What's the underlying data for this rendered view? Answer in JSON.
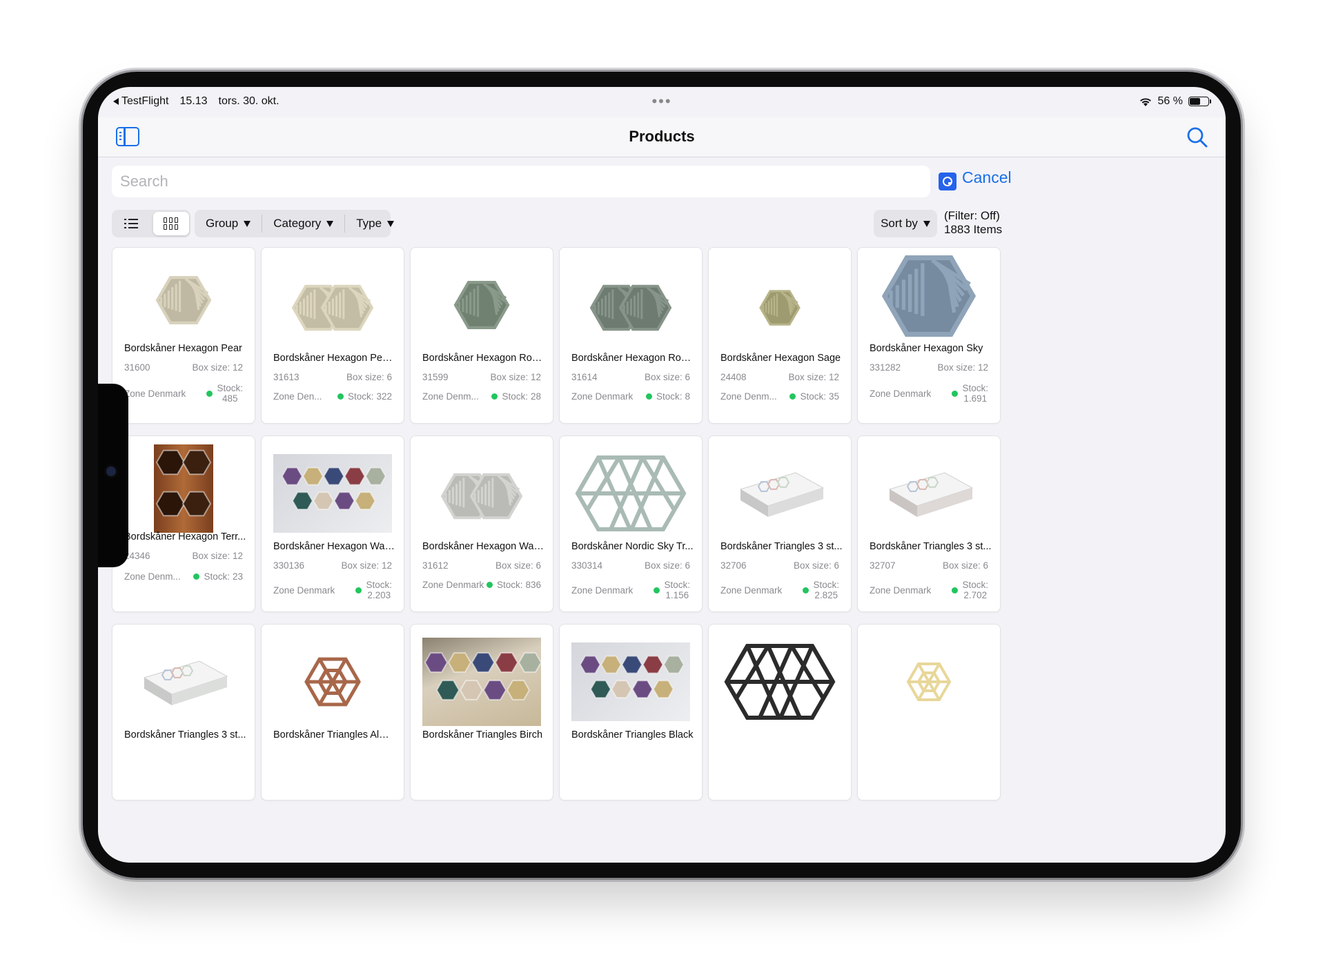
{
  "status_bar": {
    "back_app": "TestFlight",
    "time": "15.13",
    "date": "tors. 30. okt.",
    "center_dots": "•••",
    "battery": "56 %",
    "battery_level": 0.56
  },
  "nav": {
    "title": "Products"
  },
  "search": {
    "placeholder": "Search",
    "cancel_label": "Cancel"
  },
  "filters": {
    "group_label": "Group",
    "category_label": "Category",
    "type_label": "Type",
    "sort_label": "Sort by",
    "filter_state": "(Filter: Off)",
    "item_count": "1883 Items"
  },
  "products": [
    {
      "name": "Bordskåner Hexagon Pear",
      "sku": "31600",
      "box": "Box size: 12",
      "zone": "Zone Denmark",
      "stock_label": "Stock:",
      "stock": "485",
      "color": "#d8d2bd",
      "shape": "hex-small"
    },
    {
      "name": "Bordskåner Hexagon Pea...",
      "sku": "31613",
      "box": "Box size: 6",
      "zone": "Zone Den...",
      "stock_label": "Stock:",
      "stock": "322",
      "color": "#ddd6be",
      "shape": "hex-double"
    },
    {
      "name": "Bordskåner Hexagon Ros...",
      "sku": "31599",
      "box": "Box size: 12",
      "zone": "Zone Denm...",
      "stock_label": "Stock:",
      "stock": "28",
      "color": "#8a9a8a",
      "shape": "hex-small"
    },
    {
      "name": "Bordskåner Hexagon Ros...",
      "sku": "31614",
      "box": "Box size: 6",
      "zone": "Zone Denmark",
      "stock_label": "Stock:",
      "stock": "8",
      "color": "#86948a",
      "shape": "hex-double"
    },
    {
      "name": "Bordskåner Hexagon Sage",
      "sku": "24408",
      "box": "Box size: 12",
      "zone": "Zone Denm...",
      "stock_label": "Stock:",
      "stock": "35",
      "color": "#b8b48a",
      "shape": "hex-tiny"
    },
    {
      "name": "Bordskåner Hexagon Sky",
      "sku": "331282",
      "box": "Box size: 12",
      "zone": "Zone Denmark",
      "stock_label": "Stock:",
      "stock": "1.691",
      "color": "#8fa4b8",
      "shape": "hex-large"
    },
    {
      "name": "Bordskåner Hexagon Terr...",
      "sku": "24346",
      "box": "Box size: 12",
      "zone": "Zone Denm...",
      "stock_label": "Stock:",
      "stock": "23",
      "color": "#8a4f2c",
      "shape": "photo-wood"
    },
    {
      "name": "Bordskåner Hexagon War...",
      "sku": "330136",
      "box": "Box size: 12",
      "zone": "Zone Denmark",
      "stock_label": "Stock:",
      "stock": "2.203",
      "color": "#6b5a7a",
      "shape": "photo-multi"
    },
    {
      "name": "Bordskåner Hexagon War...",
      "sku": "31612",
      "box": "Box size: 6",
      "zone": "Zone Denmark",
      "stock_label": "Stock:",
      "stock": "836",
      "color": "#d3d3d0",
      "shape": "hex-double"
    },
    {
      "name": "Bordskåner Nordic Sky Tr...",
      "sku": "330314",
      "box": "Box size: 6",
      "zone": "Zone Denmark",
      "stock_label": "Stock:",
      "stock": "1.156",
      "color": "#a9bbb4",
      "shape": "tri-wide"
    },
    {
      "name": "Bordskåner Triangles 3 st...",
      "sku": "32706",
      "box": "Box size: 6",
      "zone": "Zone Denmark",
      "stock_label": "Stock:",
      "stock": "2.825",
      "color": "#e6e6e6",
      "shape": "box"
    },
    {
      "name": "Bordskåner Triangles 3 st...",
      "sku": "32707",
      "box": "Box size: 6",
      "zone": "Zone Denmark",
      "stock_label": "Stock:",
      "stock": "2.702",
      "color": "#e8e2e0",
      "shape": "box"
    },
    {
      "name": "Bordskåner Triangles 3 st...",
      "sku": "",
      "box": "",
      "zone": "",
      "stock_label": "",
      "stock": "",
      "color": "#e6e8e6",
      "shape": "box"
    },
    {
      "name": "Bordskåner Triangles Alm...",
      "sku": "",
      "box": "",
      "zone": "",
      "stock_label": "",
      "stock": "",
      "color": "#a8674a",
      "shape": "tri-hex"
    },
    {
      "name": "Bordskåner Triangles Birch",
      "sku": "",
      "box": "",
      "zone": "",
      "stock_label": "",
      "stock": "",
      "color": "#c9b693",
      "shape": "photo-birch"
    },
    {
      "name": "Bordskåner Triangles Black",
      "sku": "",
      "box": "",
      "zone": "",
      "stock_label": "",
      "stock": "",
      "color": "#55505a",
      "shape": "photo-multi"
    },
    {
      "name": "",
      "sku": "",
      "box": "",
      "zone": "",
      "stock_label": "",
      "stock": "",
      "color": "#2b2b2b",
      "shape": "tri-wide"
    },
    {
      "name": "",
      "sku": "",
      "box": "",
      "zone": "",
      "stock_label": "",
      "stock": "",
      "color": "#e8d79a",
      "shape": "tri-hex-small"
    }
  ]
}
